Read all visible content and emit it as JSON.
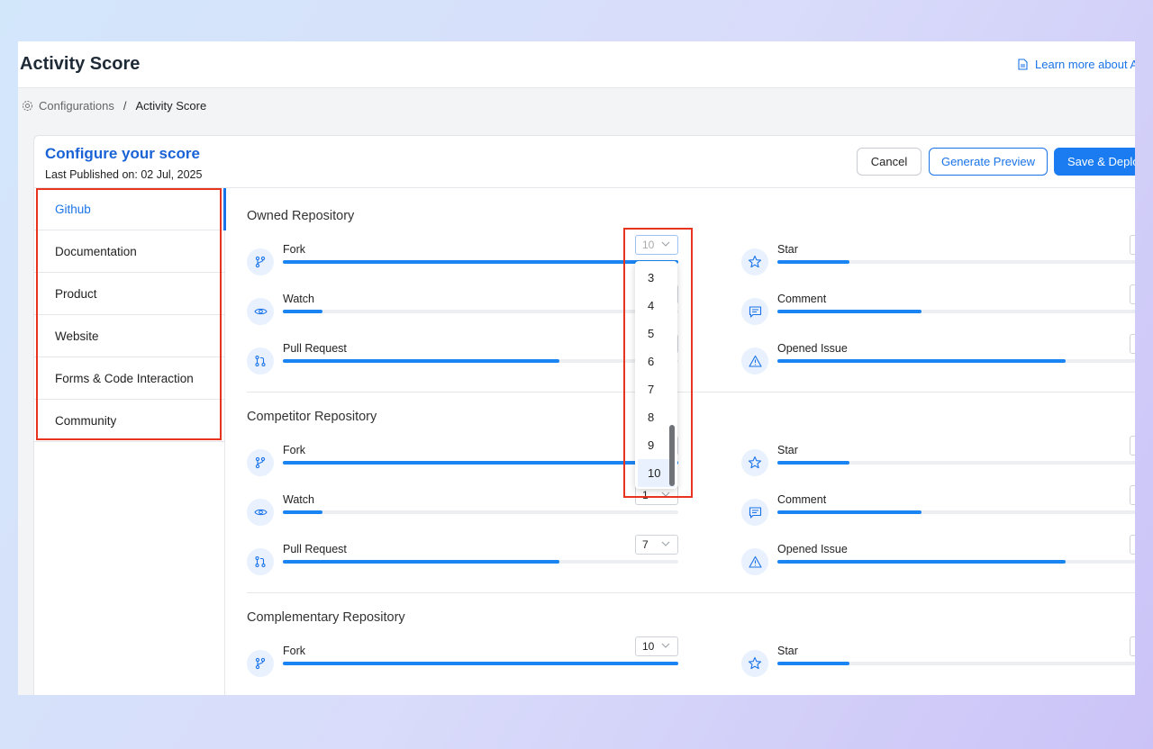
{
  "app": {
    "title": "Activity Score",
    "learn_more": "Learn more about A"
  },
  "breadcrumb": {
    "root": "Configurations",
    "separator": "/",
    "current": "Activity Score"
  },
  "card": {
    "title": "Configure your score",
    "subtitle": "Last Published on: 02 Jul, 2025",
    "buttons": {
      "cancel": "Cancel",
      "preview": "Generate Preview",
      "save": "Save & Deplo"
    }
  },
  "sidebar": {
    "items": [
      {
        "label": "Github",
        "active": true
      },
      {
        "label": "Documentation"
      },
      {
        "label": "Product"
      },
      {
        "label": "Website"
      },
      {
        "label": "Forms & Code Interaction"
      },
      {
        "label": "Community"
      }
    ]
  },
  "sections": [
    {
      "title": "Owned Repository",
      "left": [
        {
          "label": "Fork",
          "value": "10",
          "fill": 1.0,
          "icon": "fork-icon"
        },
        {
          "label": "Watch",
          "value": "",
          "fill": 0.1,
          "icon": "eye-icon"
        },
        {
          "label": "Pull Request",
          "value": "",
          "fill": 0.7,
          "icon": "pull-request-icon"
        }
      ],
      "right": [
        {
          "label": "Star",
          "fill": 0.2,
          "icon": "star-icon"
        },
        {
          "label": "Comment",
          "fill": 0.4,
          "icon": "comment-icon"
        },
        {
          "label": "Opened Issue",
          "fill": 0.8,
          "icon": "warning-icon"
        }
      ]
    },
    {
      "title": "Competitor Repository",
      "left": [
        {
          "label": "Fork",
          "value": "",
          "fill": 1.0,
          "icon": "fork-icon"
        },
        {
          "label": "Watch",
          "value": "1",
          "fill": 0.1,
          "icon": "eye-icon"
        },
        {
          "label": "Pull Request",
          "value": "7",
          "fill": 0.7,
          "icon": "pull-request-icon"
        }
      ],
      "right": [
        {
          "label": "Star",
          "fill": 0.2,
          "icon": "star-icon"
        },
        {
          "label": "Comment",
          "fill": 0.4,
          "icon": "comment-icon"
        },
        {
          "label": "Opened Issue",
          "fill": 0.8,
          "icon": "warning-icon"
        }
      ]
    },
    {
      "title": "Complementary Repository",
      "left": [
        {
          "label": "Fork",
          "value": "10",
          "fill": 1.0,
          "icon": "fork-icon"
        }
      ],
      "right": [
        {
          "label": "Star",
          "fill": 0.2,
          "icon": "star-icon"
        }
      ]
    }
  ],
  "dropdown": {
    "options": [
      "3",
      "4",
      "5",
      "6",
      "7",
      "8",
      "9",
      "10"
    ],
    "selected": "10"
  },
  "colors": {
    "accent": "#1a73e8",
    "highlight": "#e8331e"
  }
}
